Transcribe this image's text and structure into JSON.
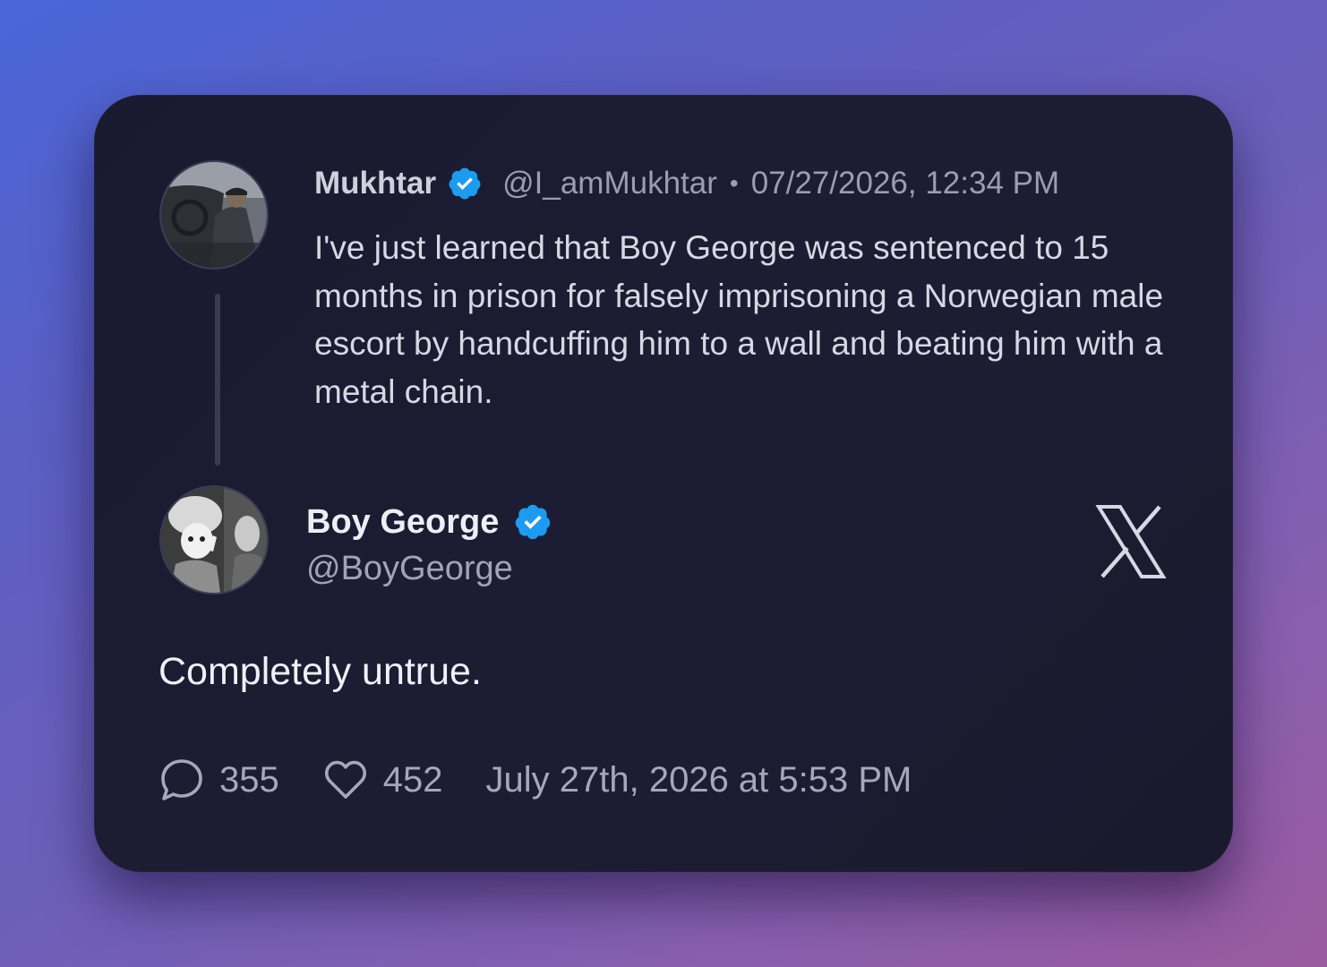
{
  "parent_tweet": {
    "author_name": "Mukhtar",
    "verified": true,
    "handle": "@I_amMukhtar",
    "separator": "•",
    "timestamp": "07/27/2026, 12:34 PM",
    "text": "I've just learned that Boy George was sentenced to 15 months in prison for falsely imprisoning a Norwegian male escort by handcuffing him to a wall and beating him with a metal chain."
  },
  "reply_tweet": {
    "author_name": "Boy George",
    "verified": true,
    "handle": "@BoyGeorge",
    "text": "Completely untrue.",
    "reply_count": "355",
    "like_count": "452",
    "timestamp": "July 27th, 2026 at 5:53 PM"
  },
  "icons": {
    "verified": "verified-badge-icon",
    "brand": "x-logo-icon",
    "reply": "comment-bubble-icon",
    "like": "heart-icon"
  },
  "colors": {
    "verified_blue": "#1d9bf0",
    "card_background": "#1b1b31"
  }
}
